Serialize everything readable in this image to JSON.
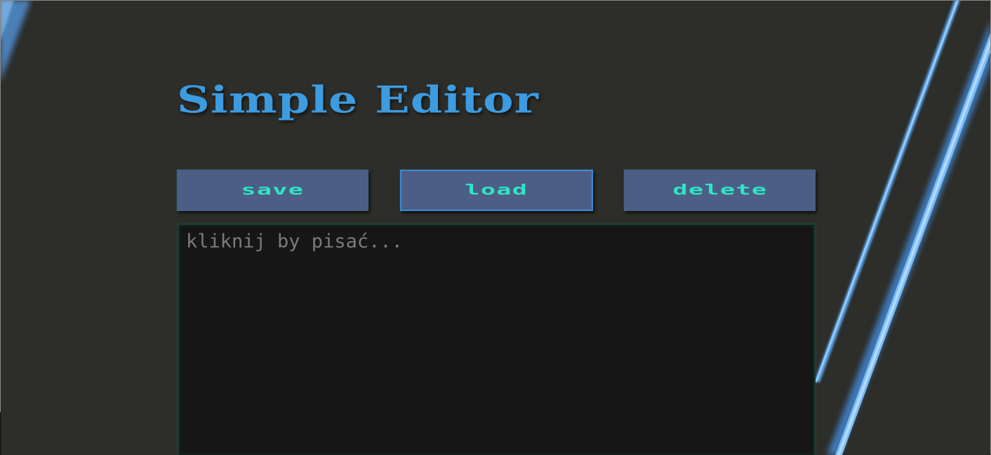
{
  "app": {
    "title": "Simple Editor"
  },
  "toolbar": {
    "save_label": "save",
    "load_label": "load",
    "delete_label": "delete"
  },
  "editor": {
    "value": "",
    "placeholder": "kliknij by pisać..."
  },
  "colors": {
    "background": "#2d2d29",
    "title": "#3d9be0",
    "button_bg": "#4c5e85",
    "button_text": "#2ee6c7",
    "editor_bg": "#151615",
    "stripe": "#5aa8ee"
  }
}
